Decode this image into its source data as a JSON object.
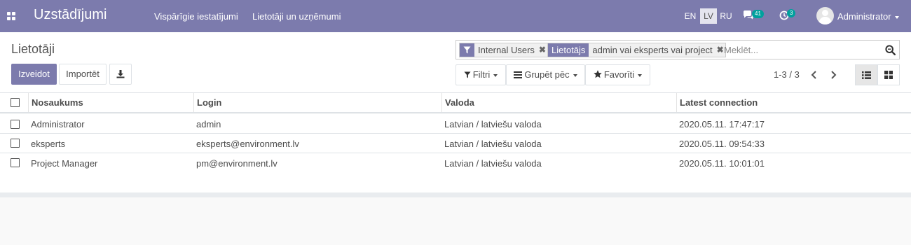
{
  "app": {
    "title": "Uzstādījumi"
  },
  "top_menu": {
    "items": [
      {
        "label": "Vispārīgie iestatījumi"
      },
      {
        "label": "Lietotāji un uzņēmumi"
      }
    ]
  },
  "languages": [
    {
      "code": "EN",
      "active": false
    },
    {
      "code": "LV",
      "active": true
    },
    {
      "code": "RU",
      "active": false
    }
  ],
  "systray": {
    "messages_icon": "chat-bubbles-icon",
    "messages_count": "41",
    "activities_icon": "clock-icon",
    "activities_count": "3",
    "user_name": "Administrator"
  },
  "breadcrumb": "Lietotāji",
  "buttons": {
    "create": "Izveidot",
    "import": "Importēt",
    "download_icon": "download-icon"
  },
  "search": {
    "facets": [
      {
        "label_icon": "filter-icon",
        "values": "Internal Users"
      },
      {
        "label": "Lietotājs",
        "values": "admin vai eksperts vai project"
      }
    ],
    "placeholder": "Meklēt..."
  },
  "search_options": {
    "filters": "Filtri",
    "group_by": "Grupēt pēc",
    "favorites": "Favorīti"
  },
  "pager": {
    "value": "1-3 / 3"
  },
  "views": {
    "list_icon": "list-view-icon",
    "kanban_icon": "kanban-view-icon",
    "active": "list"
  },
  "colors": {
    "brand": "#7c7bad",
    "badge": "#00a09d"
  },
  "table": {
    "columns": [
      "Nosaukums",
      "Login",
      "Valoda",
      "Latest connection"
    ],
    "rows": [
      [
        "Administrator",
        "admin",
        "Latvian / latviešu valoda",
        "2020.05.11. 17:47:17"
      ],
      [
        "eksperts",
        "eksperts@environment.lv",
        "Latvian / latviešu valoda",
        "2020.05.11. 09:54:33"
      ],
      [
        "Project Manager",
        "pm@environment.lv",
        "Latvian / latviešu valoda",
        "2020.05.11. 10:01:01"
      ]
    ]
  }
}
